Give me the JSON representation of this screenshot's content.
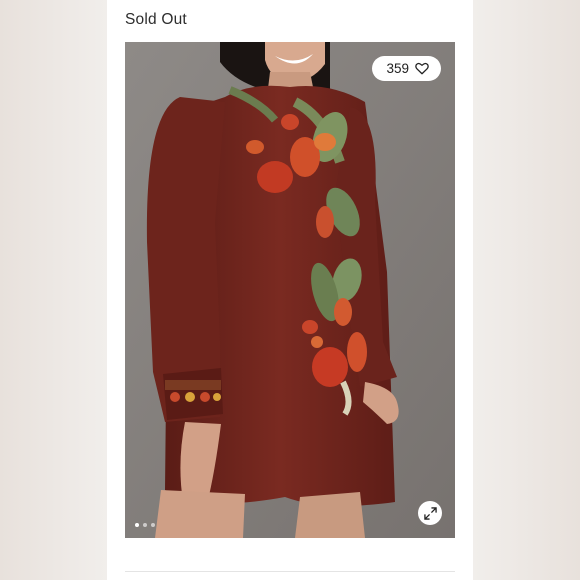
{
  "listing": {
    "status_label": "Sold Out",
    "like_count": "359"
  },
  "gallery": {
    "image_count": 3,
    "active_index": 0
  },
  "icons": {
    "like": "heart-icon",
    "expand": "expand-icon"
  },
  "colors": {
    "dress": "#6b231c",
    "background": "#8a8582"
  }
}
